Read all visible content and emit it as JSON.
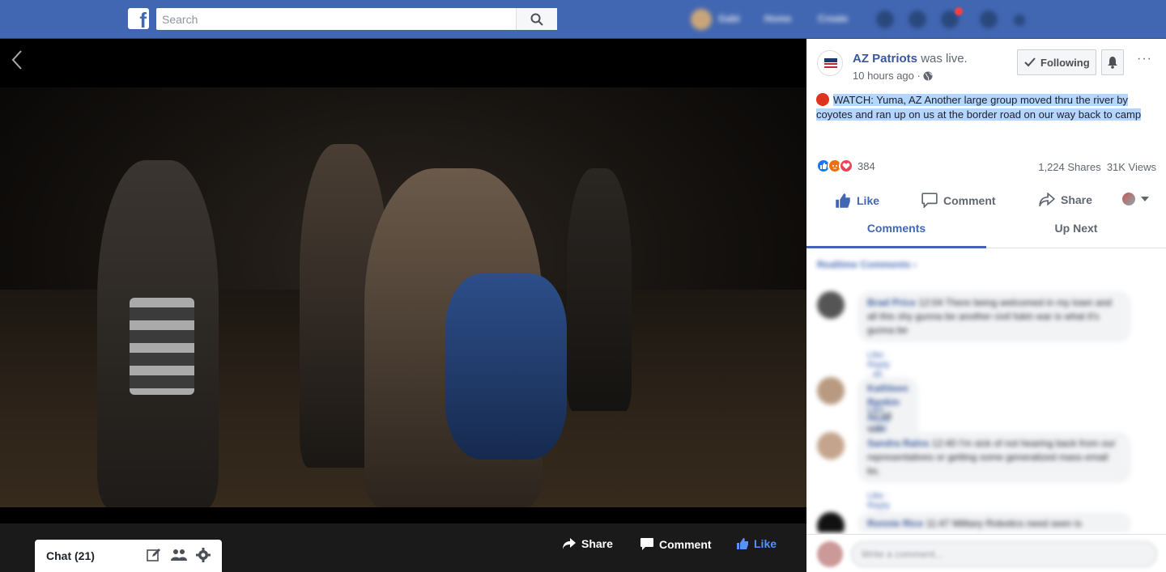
{
  "topbar": {
    "logo": "f",
    "search_placeholder": "Search",
    "nav": {
      "user": "Gabi",
      "home": "Home",
      "create": "Create"
    }
  },
  "video_bar": {
    "share": "Share",
    "comment": "Comment",
    "like": "Like"
  },
  "chat": {
    "label": "Chat (21)"
  },
  "post": {
    "page_name": "AZ Patriots",
    "was_live": "was live.",
    "time": "10 hours ago ·",
    "following": "Following",
    "more": "···",
    "text": "WATCH: Yuma, AZ Another large group moved thru the river by coyotes and ran up on us at the border road on our way back to camp",
    "reaction_count": "384",
    "shares": "1,224 Shares",
    "views": "31K Views"
  },
  "actions": {
    "like": "Like",
    "comment": "Comment",
    "share": "Share"
  },
  "tabs": [
    {
      "label": "Comments"
    },
    {
      "label": "Up Next"
    }
  ],
  "comments": {
    "realtime": "Realtime Comments ›",
    "items": [
      {
        "name": "Brad Price",
        "time": "12:04",
        "text": "There being welcomed in my town and all this shy gunna be another civil fukin war is what it's gunna be",
        "meta": "Like · Reply · 4h"
      },
      {
        "name": "Kathleen Rankin",
        "time": "12:18",
        "text": "Wtb",
        "meta": "Like · Reply · 11h"
      },
      {
        "name": "Sandra Ralns",
        "time": "12:40",
        "text": "I'm sick of not hearing back from our representatives or getting some generalized mass email bs.",
        "meta": "Like · Reply · 11h"
      },
      {
        "name": "Ronnie Rice",
        "time": "11:47",
        "text": "Military Robotics need seen is",
        "meta": ""
      }
    ],
    "write_placeholder": "Write a comment..."
  }
}
